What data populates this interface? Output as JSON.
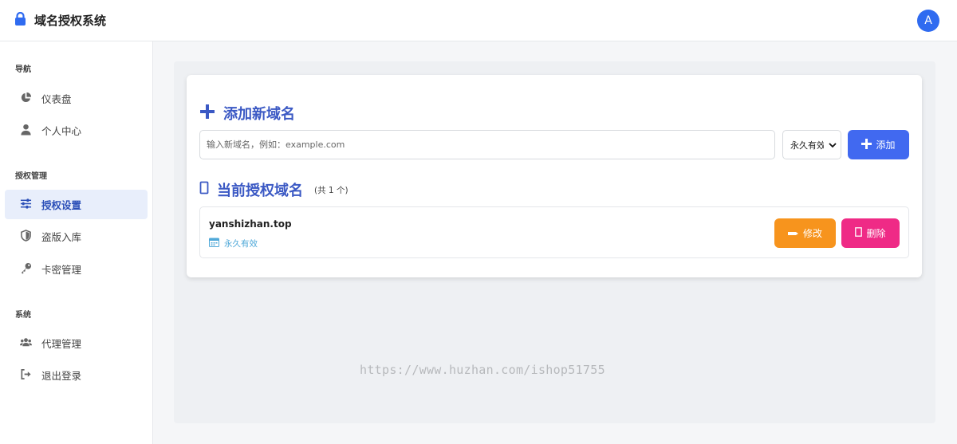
{
  "header": {
    "title": "域名授权系统",
    "avatar_letter": "A",
    "icon": "lock-icon"
  },
  "sidebar": {
    "sections": [
      {
        "title": "导航",
        "items": [
          {
            "label": "仪表盘",
            "icon": "chart-pie-icon"
          },
          {
            "label": "个人中心",
            "icon": "user-icon"
          }
        ]
      },
      {
        "title": "授权管理",
        "items": [
          {
            "label": "授权设置",
            "icon": "sliders-icon",
            "active": true
          },
          {
            "label": "盗版入库",
            "icon": "shield-icon"
          },
          {
            "label": "卡密管理",
            "icon": "key-icon"
          }
        ]
      },
      {
        "title": "系统",
        "items": [
          {
            "label": "代理管理",
            "icon": "users-icon"
          },
          {
            "label": "退出登录",
            "icon": "sign-out-icon"
          }
        ]
      }
    ]
  },
  "add_domain": {
    "heading": "添加新域名",
    "input_placeholder": "输入新域名，例如：example.com",
    "input_value": "",
    "duration_selected": "永久有效",
    "add_label": "添加"
  },
  "current_domains": {
    "heading": "当前授权域名",
    "count_text": "(共 1 个)",
    "items": [
      {
        "domain": "yanshizhan.top",
        "validity": "永久有效"
      }
    ],
    "edit_label": "修改",
    "delete_label": "删除"
  },
  "watermark": "https://www.huzhan.com/ishop51755",
  "colors": {
    "primary": "#4169f0",
    "heading": "#3b59c4",
    "edit": "#f7941d",
    "delete": "#ef2a86",
    "active_bg": "#e8eefb"
  }
}
